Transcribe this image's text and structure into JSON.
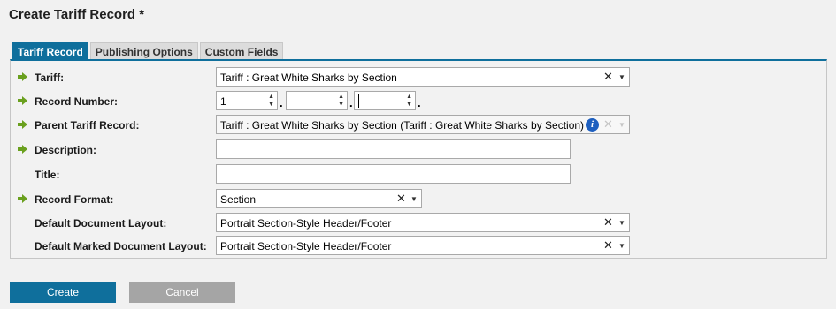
{
  "page_title": "Create Tariff Record *",
  "tabs": [
    {
      "label": "Tariff Record",
      "active": true
    },
    {
      "label": "Publishing Options",
      "active": false
    },
    {
      "label": "Custom Fields",
      "active": false
    }
  ],
  "form": {
    "tariff": {
      "label": "Tariff:",
      "value": "Tariff : Great White Sharks by Section"
    },
    "record_number": {
      "label": "Record Number:",
      "part1": "1",
      "part2": "",
      "part3": "",
      "sep": "."
    },
    "parent": {
      "label": "Parent Tariff Record:",
      "value": "Tariff : Great White Sharks by Section (Tariff : Great White Sharks by Section)",
      "info": "i"
    },
    "description": {
      "label": "Description:",
      "value": ""
    },
    "title": {
      "label": "Title:",
      "value": ""
    },
    "record_format": {
      "label": "Record Format:",
      "value": "Section"
    },
    "doc_layout": {
      "label": "Default Document Layout:",
      "value": "Portrait Section-Style Header/Footer"
    },
    "marked_layout": {
      "label": "Default Marked Document Layout:",
      "value": "Portrait Section-Style Header/Footer"
    }
  },
  "icons": {
    "clear": "✕",
    "dropdown": "▼",
    "spin_up": "▲",
    "spin_down": "▼",
    "required_arrow": "green-arrow-icon"
  },
  "buttons": {
    "create": "Create",
    "cancel": "Cancel"
  },
  "colors": {
    "accent": "#0f6f9c",
    "required_arrow": "#6aa01e",
    "cancel_bg": "#a5a5a5"
  }
}
